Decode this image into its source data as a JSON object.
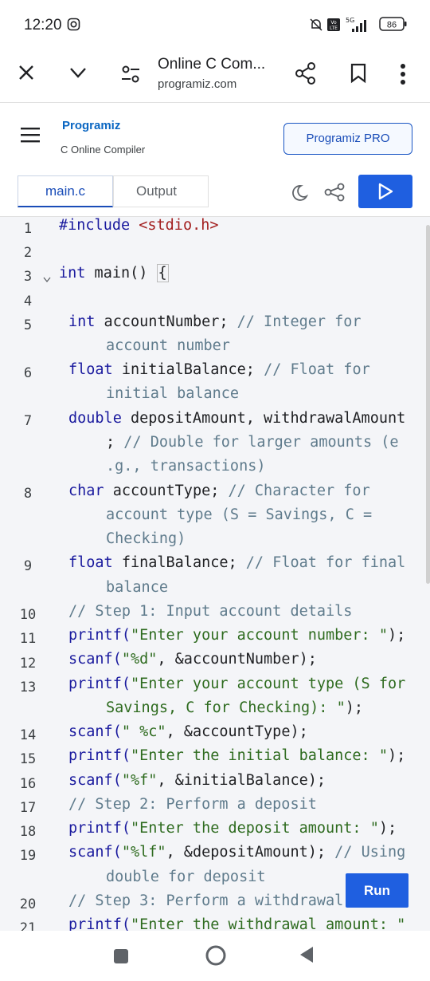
{
  "status": {
    "time": "12:20",
    "battery": "86",
    "network": "5G"
  },
  "browser": {
    "title": "Online C Com...",
    "url": "programiz.com"
  },
  "site": {
    "logo": "Programiz",
    "subtitle": "C Online Compiler",
    "pro_button": "Programiz PRO"
  },
  "tabs": {
    "main": "main.c",
    "output": "Output"
  },
  "editor": {
    "line_numbers": [
      "1",
      "2",
      "3",
      "4",
      "5",
      "6",
      "7",
      "8",
      "9",
      "10",
      "11",
      "12",
      "13",
      "14",
      "15",
      "16",
      "17",
      "18",
      "19",
      "20",
      "21"
    ],
    "run_label": "Run",
    "lines": [
      {
        "parts": [
          {
            "t": "#include ",
            "c": "kw"
          },
          {
            "t": "<stdio.h>",
            "c": "inc"
          }
        ]
      },
      {
        "parts": [
          {
            "t": "int",
            "c": "kw"
          },
          {
            "t": " main() ",
            "c": "p"
          },
          {
            "t": "{",
            "c": "brace"
          }
        ]
      },
      {
        "parts": [
          {
            "t": "int",
            "c": "kw"
          },
          {
            "t": " accountNumber; ",
            "c": "p"
          },
          {
            "t": "// Integer for",
            "c": "cm"
          }
        ]
      },
      {
        "parts": [
          {
            "t": "account number",
            "c": "cm"
          }
        ]
      },
      {
        "parts": [
          {
            "t": "float",
            "c": "kw"
          },
          {
            "t": " initialBalance; ",
            "c": "p"
          },
          {
            "t": "// Float for",
            "c": "cm"
          }
        ]
      },
      {
        "parts": [
          {
            "t": "initial balance",
            "c": "cm"
          }
        ]
      },
      {
        "parts": [
          {
            "t": "double",
            "c": "kw"
          },
          {
            "t": " depositAmount, withdrawalAmount",
            "c": "p"
          }
        ]
      },
      {
        "parts": [
          {
            "t": "; ",
            "c": "p"
          },
          {
            "t": "// Double for larger amounts (e",
            "c": "cm"
          }
        ]
      },
      {
        "parts": [
          {
            "t": ".g., transactions)",
            "c": "cm"
          }
        ]
      },
      {
        "parts": [
          {
            "t": "char",
            "c": "kw"
          },
          {
            "t": " accountType; ",
            "c": "p"
          },
          {
            "t": "// Character for",
            "c": "cm"
          }
        ]
      },
      {
        "parts": [
          {
            "t": "account type (S = Savings, C =",
            "c": "cm"
          }
        ]
      },
      {
        "parts": [
          {
            "t": "Checking)",
            "c": "cm"
          }
        ]
      },
      {
        "parts": [
          {
            "t": "float",
            "c": "kw"
          },
          {
            "t": " finalBalance; ",
            "c": "p"
          },
          {
            "t": "// Float for final",
            "c": "cm"
          }
        ]
      },
      {
        "parts": [
          {
            "t": "balance",
            "c": "cm"
          }
        ]
      },
      {
        "parts": [
          {
            "t": "// Step 1: Input account details",
            "c": "cm"
          }
        ]
      },
      {
        "parts": [
          {
            "t": "printf(",
            "c": "kw"
          },
          {
            "t": "\"Enter your account number: \"",
            "c": "str"
          },
          {
            "t": ");",
            "c": "p"
          }
        ]
      },
      {
        "parts": [
          {
            "t": "scanf(",
            "c": "kw"
          },
          {
            "t": "\"%d\"",
            "c": "str"
          },
          {
            "t": ", &accountNumber);",
            "c": "p"
          }
        ]
      },
      {
        "parts": [
          {
            "t": "printf(",
            "c": "kw"
          },
          {
            "t": "\"Enter your account type (S for",
            "c": "str"
          }
        ]
      },
      {
        "parts": [
          {
            "t": "Savings, C for Checking): \"",
            "c": "str"
          },
          {
            "t": ");",
            "c": "p"
          }
        ]
      },
      {
        "parts": [
          {
            "t": "scanf(",
            "c": "kw"
          },
          {
            "t": "\" %c\"",
            "c": "str"
          },
          {
            "t": ", &accountType);",
            "c": "p"
          }
        ]
      },
      {
        "parts": [
          {
            "t": "printf(",
            "c": "kw"
          },
          {
            "t": "\"Enter the initial balance: \"",
            "c": "str"
          },
          {
            "t": ");",
            "c": "p"
          }
        ]
      },
      {
        "parts": [
          {
            "t": "scanf(",
            "c": "kw"
          },
          {
            "t": "\"%f\"",
            "c": "str"
          },
          {
            "t": ", &initialBalance);",
            "c": "p"
          }
        ]
      },
      {
        "parts": [
          {
            "t": "// Step 2: Perform a deposit",
            "c": "cm"
          }
        ]
      },
      {
        "parts": [
          {
            "t": "printf(",
            "c": "kw"
          },
          {
            "t": "\"Enter the deposit amount: \"",
            "c": "str"
          },
          {
            "t": ");",
            "c": "p"
          }
        ]
      },
      {
        "parts": [
          {
            "t": "scanf(",
            "c": "kw"
          },
          {
            "t": "\"%lf\"",
            "c": "str"
          },
          {
            "t": ", &depositAmount); ",
            "c": "p"
          },
          {
            "t": "// Using",
            "c": "cm"
          }
        ]
      },
      {
        "parts": [
          {
            "t": "double for deposit",
            "c": "cm"
          }
        ]
      },
      {
        "parts": [
          {
            "t": "// Step 3: Perform a withdrawal",
            "c": "cm"
          }
        ]
      },
      {
        "parts": [
          {
            "t": "printf(",
            "c": "kw"
          },
          {
            "t": "\"Enter the withdrawal amount: \"",
            "c": "str"
          }
        ]
      }
    ]
  }
}
